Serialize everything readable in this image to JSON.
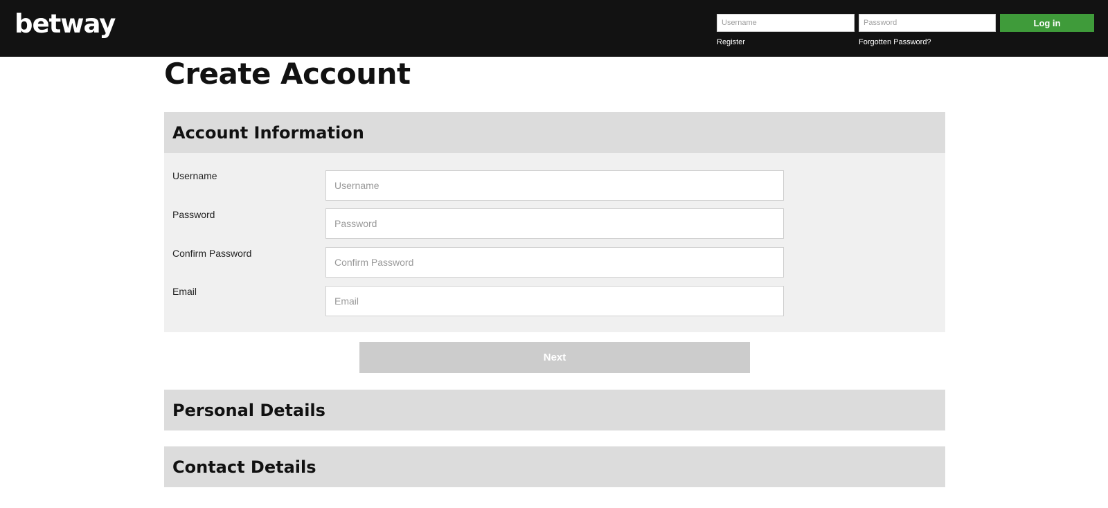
{
  "header": {
    "logo_text": "betway",
    "username_placeholder": "Username",
    "password_placeholder": "Password",
    "login_label": "Log in",
    "register_label": "Register",
    "forgot_label": "Forgotten Password?",
    "login_color": "#3f9b3a",
    "bar_color": "#121212"
  },
  "page": {
    "title": "Create Account"
  },
  "account_section": {
    "title": "Account Information",
    "fields": [
      {
        "label": "Username",
        "placeholder": "Username"
      },
      {
        "label": "Password",
        "placeholder": "Password"
      },
      {
        "label": "Confirm Password",
        "placeholder": "Confirm Password"
      },
      {
        "label": "Email",
        "placeholder": "Email"
      }
    ],
    "next_label": "Next"
  },
  "personal_section": {
    "title": "Personal Details"
  },
  "contact_section": {
    "title": "Contact Details"
  }
}
